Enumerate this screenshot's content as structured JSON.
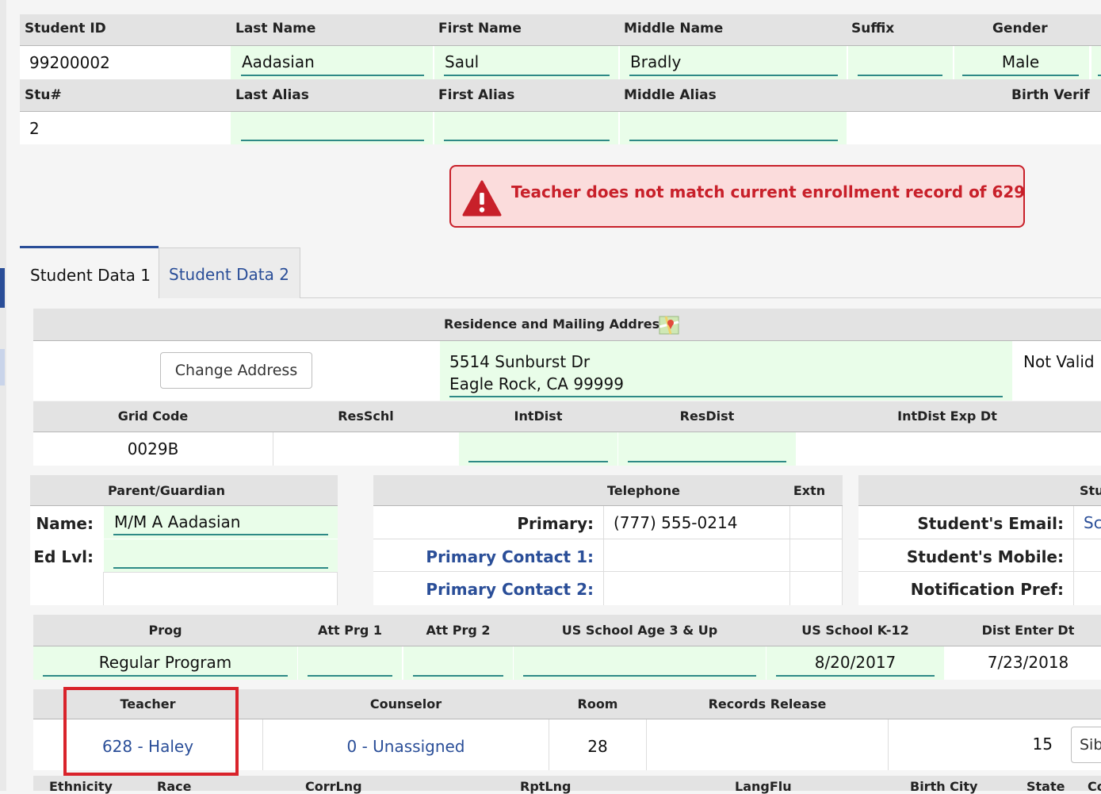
{
  "student": {
    "headers": [
      "Student ID",
      "Last Name",
      "First Name",
      "Middle Name",
      "Suffix",
      "Gender"
    ],
    "id": "99200002",
    "last_name": "Aadasian",
    "first_name": "Saul",
    "middle_name": "Bradly",
    "suffix": "",
    "gender": "Male",
    "headers2": [
      "Stu#",
      "Last Alias",
      "First Alias",
      "Middle Alias",
      "Birth Verif"
    ],
    "stu_num": "2",
    "last_alias": "",
    "first_alias": "",
    "middle_alias": ""
  },
  "alert": {
    "message": "Teacher does not match current enrollment record of 629",
    "color": "#c8202a",
    "background": "#fbdcdc"
  },
  "tabs": [
    {
      "label": "Student Data 1",
      "active": true
    },
    {
      "label": "Student Data 2",
      "active": false
    }
  ],
  "address": {
    "title": "Residence and Mailing Address",
    "change_button": "Change Address",
    "line1": "5514 Sunburst Dr",
    "line2": "Eagle Rock, CA 99999",
    "status": "Not Valid",
    "headers": [
      "Grid Code",
      "ResSchl",
      "IntDist",
      "ResDist",
      "IntDist Exp Dt"
    ],
    "grid_code": "0029B"
  },
  "parent": {
    "title": "Parent/Guardian",
    "name_label": "Name:",
    "name": "M/M A Aadasian",
    "edlvl_label": "Ed Lvl:",
    "edlvl": ""
  },
  "telephone": {
    "title": "Telephone",
    "extn_title": "Extn",
    "primary_label": "Primary:",
    "primary": "(777) 555-0214",
    "contact1_label": "Primary Contact 1:",
    "contact2_label": "Primary Contact 2:"
  },
  "student_contact": {
    "title": "Stu",
    "email_label": "Student's Email:",
    "email_value": "Sc",
    "mobile_label": "Student's Mobile:",
    "notif_label": "Notification Pref:"
  },
  "program": {
    "headers": [
      "Prog",
      "Att Prg 1",
      "Att Prg 2",
      "US School Age 3 & Up",
      "US School K-12",
      "Dist Enter Dt"
    ],
    "prog": "Regular Program",
    "us_k12": "8/20/2017",
    "dist_enter": "7/23/2018"
  },
  "assignment": {
    "headers": [
      "Teacher",
      "Counselor",
      "Room",
      "Records Release"
    ],
    "teacher": "628 - Haley",
    "counselor": "0 - Unassigned",
    "room": "28",
    "count": "15",
    "sib_button": "Sib",
    "highlight_color": "#d9232b"
  },
  "bottom_headers": [
    "Ethnicity",
    "Race",
    "CorrLng",
    "RptLng",
    "LangFlu",
    "Birth City",
    "State",
    "Co"
  ],
  "colors": {
    "link": "#2a4e98",
    "field_green": "#e9fde9",
    "field_underline": "#2e8a86",
    "header_gray": "#e3e3e3"
  }
}
